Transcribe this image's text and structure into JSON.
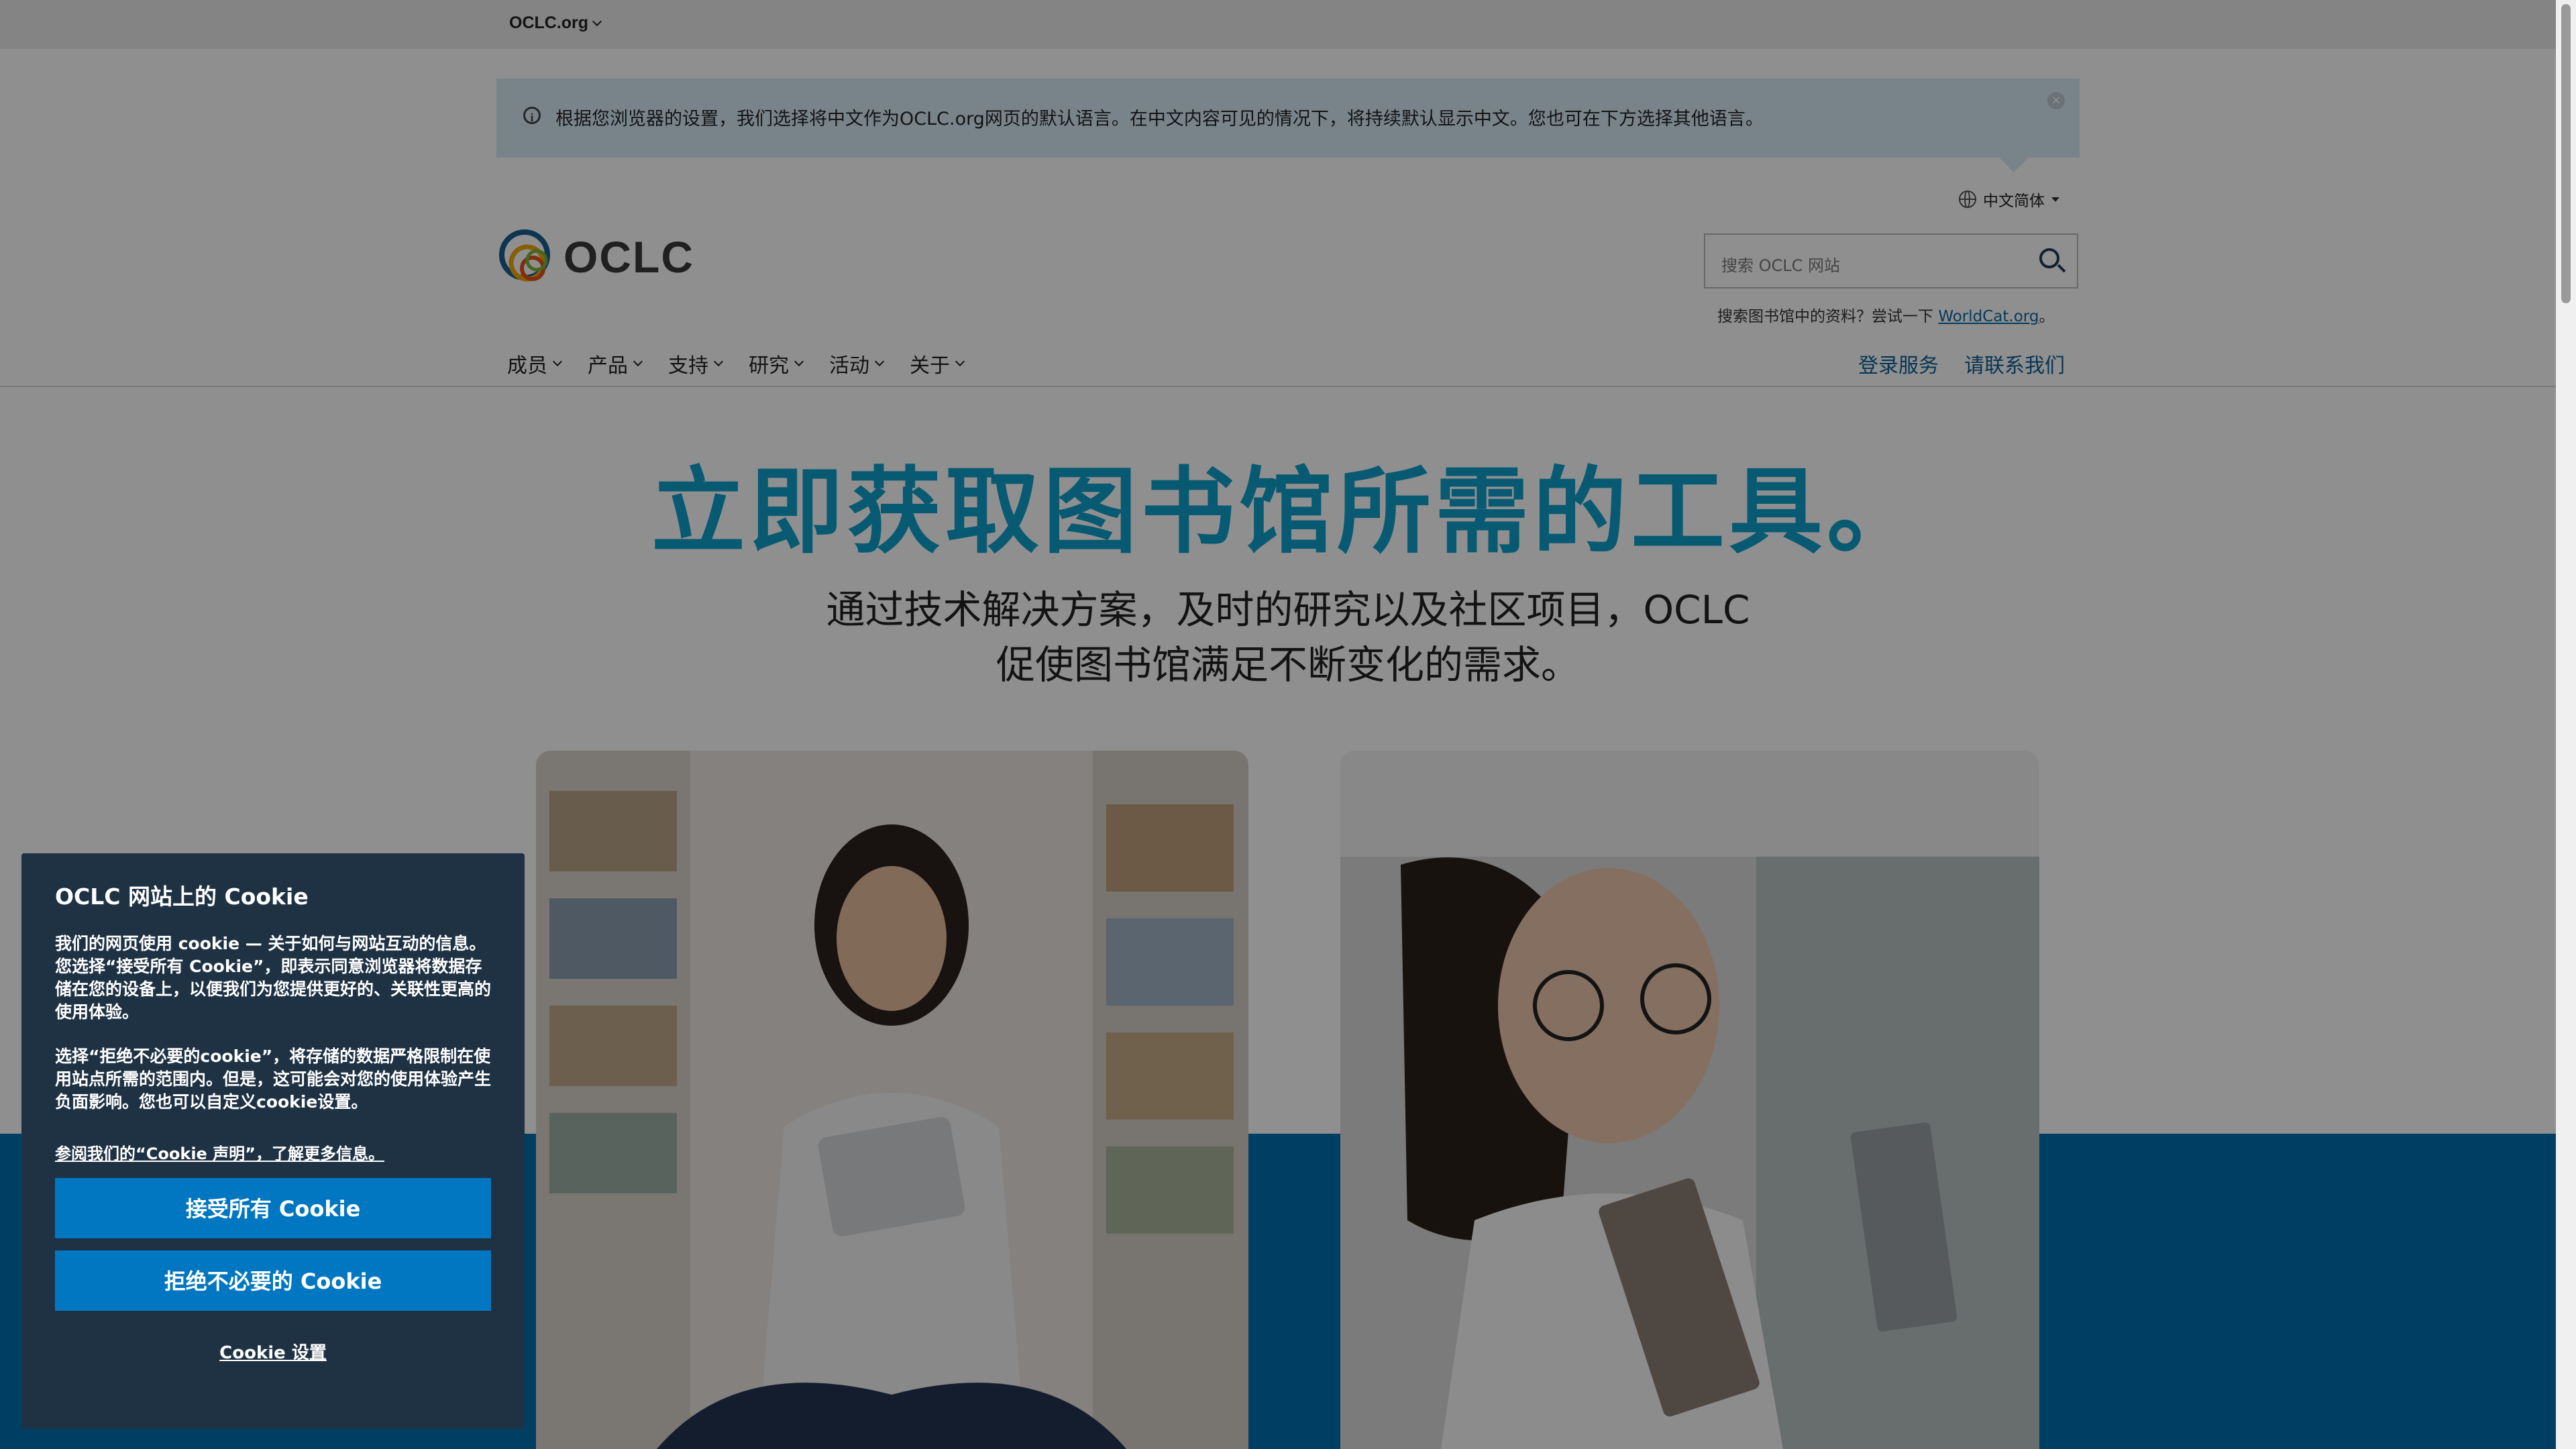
{
  "topbar": {
    "site_label": "OCLC.org"
  },
  "language_banner": {
    "message": "根据您浏览器的设置，我们选择将中文作为OCLC.org网页的默认语言。在中文内容可见的情况下，将持续默认显示中文。您也可在下方选择其他语言。",
    "close_label": "×"
  },
  "language_selector": {
    "value": "中文简体"
  },
  "logo": {
    "text": "OCLC"
  },
  "search": {
    "placeholder": "搜索 OCLC 网站",
    "worldcat_prefix": "搜索图书馆中的资料？尝试一下",
    "worldcat_link": "WorldCat.org",
    "worldcat_suffix": "。"
  },
  "nav": {
    "items": [
      {
        "label": "成员"
      },
      {
        "label": "产品"
      },
      {
        "label": "支持"
      },
      {
        "label": "研究"
      },
      {
        "label": "活动"
      },
      {
        "label": "关于"
      }
    ],
    "login": "登录服务",
    "contact": "请联系我们"
  },
  "hero": {
    "title": "立即获取图书馆所需的工具。",
    "subtitle": "通过技术解决方案，及时的研究以及社区项目，OCLC 促使图书馆满足不断变化的需求。"
  },
  "cookie_banner": {
    "title": "OCLC 网站上的 Cookie",
    "paragraph1": "我们的网页使用 cookie — 关于如何与网站互动的信息。您选择“接受所有 Cookie”，即表示同意浏览器将数据存储在您的设备上，以便我们为您提供更好的、关联性更高的使用体验。",
    "paragraph2": "选择“拒绝不必要的cookie”，将存储的数据严格限制在使用站点所需的范围内。但是，这可能会对您的使用体验产生负面影响。您也可以自定义cookie设置。",
    "policy_link": "参阅我们的“Cookie 声明”，了解更多信息。",
    "accept_button": "接受所有 Cookie",
    "reject_button": "拒绝不必要的 Cookie",
    "settings_link": "Cookie 设置"
  },
  "colors": {
    "accent": "#0fa0cb",
    "brand_blue": "#0071b3",
    "cookie_bg": "#1f3244",
    "cookie_button": "#0077c0"
  }
}
